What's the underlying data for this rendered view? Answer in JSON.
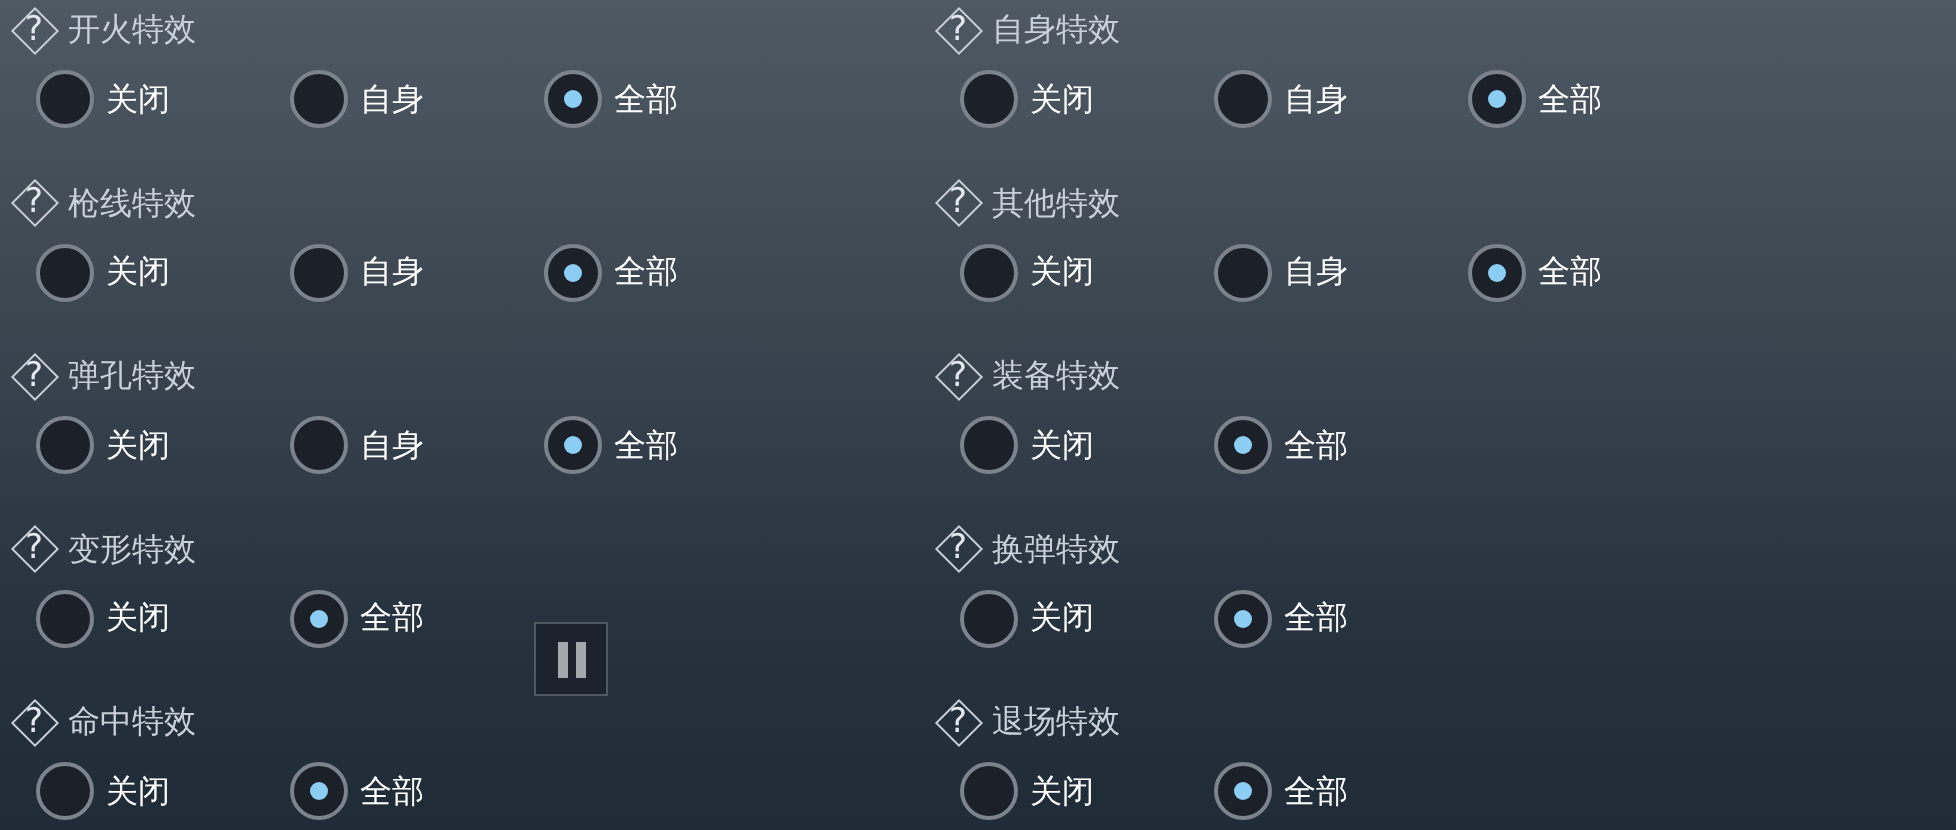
{
  "settings": [
    {
      "help": "?",
      "title": "开火特效",
      "options": [
        {
          "label": "关闭",
          "selected": false
        },
        {
          "label": "自身",
          "selected": false
        },
        {
          "label": "全部",
          "selected": true
        }
      ]
    },
    {
      "help": "?",
      "title": "自身特效",
      "options": [
        {
          "label": "关闭",
          "selected": false
        },
        {
          "label": "自身",
          "selected": false
        },
        {
          "label": "全部",
          "selected": true
        }
      ]
    },
    {
      "help": "?",
      "title": "枪线特效",
      "options": [
        {
          "label": "关闭",
          "selected": false
        },
        {
          "label": "自身",
          "selected": false
        },
        {
          "label": "全部",
          "selected": true
        }
      ]
    },
    {
      "help": "?",
      "title": "其他特效",
      "options": [
        {
          "label": "关闭",
          "selected": false
        },
        {
          "label": "自身",
          "selected": false
        },
        {
          "label": "全部",
          "selected": true
        }
      ]
    },
    {
      "help": "?",
      "title": "弹孔特效",
      "options": [
        {
          "label": "关闭",
          "selected": false
        },
        {
          "label": "自身",
          "selected": false
        },
        {
          "label": "全部",
          "selected": true
        }
      ]
    },
    {
      "help": "?",
      "title": "装备特效",
      "options": [
        {
          "label": "关闭",
          "selected": false
        },
        {
          "label": "全部",
          "selected": true
        }
      ]
    },
    {
      "help": "?",
      "title": "变形特效",
      "options": [
        {
          "label": "关闭",
          "selected": false
        },
        {
          "label": "全部",
          "selected": true
        }
      ]
    },
    {
      "help": "?",
      "title": "换弹特效",
      "options": [
        {
          "label": "关闭",
          "selected": false
        },
        {
          "label": "全部",
          "selected": true
        }
      ]
    },
    {
      "help": "?",
      "title": "命中特效",
      "options": [
        {
          "label": "关闭",
          "selected": false
        },
        {
          "label": "全部",
          "selected": true
        }
      ]
    },
    {
      "help": "?",
      "title": "退场特效",
      "options": [
        {
          "label": "关闭",
          "selected": false
        },
        {
          "label": "全部",
          "selected": true
        }
      ]
    }
  ]
}
